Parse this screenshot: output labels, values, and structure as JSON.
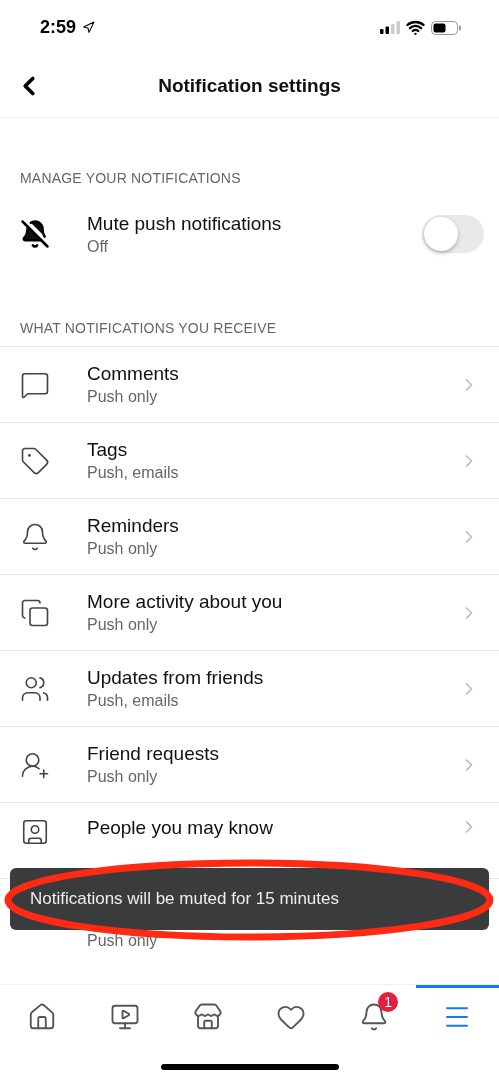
{
  "status_bar": {
    "time": "2:59"
  },
  "nav": {
    "title": "Notification settings"
  },
  "sections": [
    {
      "header": "MANAGE YOUR NOTIFICATIONS"
    },
    {
      "header": "WHAT NOTIFICATIONS YOU RECEIVE"
    }
  ],
  "mute": {
    "title": "Mute push notifications",
    "subtitle": "Off",
    "on": false
  },
  "items": [
    {
      "title": "Comments",
      "subtitle": "Push only"
    },
    {
      "title": "Tags",
      "subtitle": "Push, emails"
    },
    {
      "title": "Reminders",
      "subtitle": "Push only"
    },
    {
      "title": "More activity about you",
      "subtitle": "Push only"
    },
    {
      "title": "Updates from friends",
      "subtitle": "Push, emails"
    },
    {
      "title": "Friend requests",
      "subtitle": "Push only"
    },
    {
      "title": "People you may know"
    },
    {
      "subtitle": "Push only"
    }
  ],
  "toast": {
    "text": "Notifications will be muted for 15 minutes"
  },
  "tab_bar": [
    {
      "selected": false
    },
    {
      "selected": false
    },
    {
      "selected": false
    },
    {
      "selected": false
    },
    {
      "selected": false,
      "badge": "1"
    },
    {
      "selected": true
    }
  ]
}
